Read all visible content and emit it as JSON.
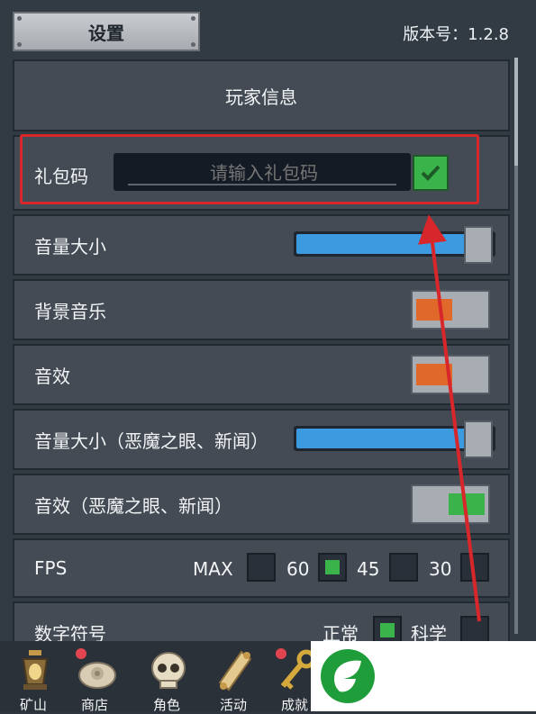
{
  "header": {
    "title": "设置",
    "version": "版本号：1.2.8"
  },
  "rows": {
    "player_info": "玩家信息",
    "gift_code": {
      "label": "礼包码",
      "placeholder": "请输入礼包码"
    },
    "volume": {
      "label": "音量大小",
      "level": 0.94
    },
    "bgm": {
      "label": "背景音乐",
      "state": "off"
    },
    "sfx": {
      "label": "音效",
      "state": "off"
    },
    "volume_special": {
      "label": "音量大小（恶魔之眼、新闻）",
      "level": 0.94
    },
    "sfx_special": {
      "label": "音效（恶魔之眼、新闻）",
      "state": "on"
    },
    "fps": {
      "label": "FPS",
      "options": [
        "MAX",
        "60",
        "45",
        "30"
      ],
      "selected": "60"
    },
    "number_format": {
      "label": "数字符号",
      "options": [
        "正常",
        "科学"
      ],
      "selected": "正常"
    }
  },
  "nav": [
    {
      "label": "矿山",
      "icon": "lantern-icon",
      "badge": false
    },
    {
      "label": "商店",
      "icon": "ore-icon",
      "badge": true
    },
    {
      "label": "角色",
      "icon": "skull-icon",
      "badge": false
    },
    {
      "label": "活动",
      "icon": "scroll-icon",
      "badge": false
    },
    {
      "label": "成就",
      "icon": "key-icon",
      "badge": true
    }
  ],
  "colors": {
    "accent_blue": "#3b9ae0",
    "toggle_off": "#e0682a",
    "toggle_on": "#39b34a",
    "highlight": "#d7272b"
  }
}
